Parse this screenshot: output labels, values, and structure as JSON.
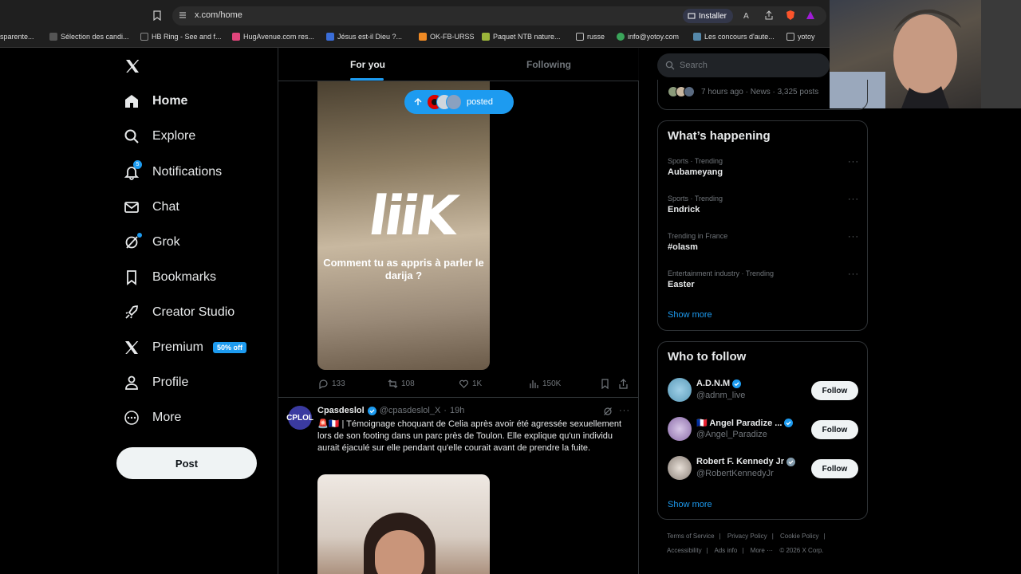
{
  "browser": {
    "url": "x.com/home",
    "install_label": "Installer",
    "bookmarks": [
      "sparente...",
      "Sélection des candi...",
      "HB Ring - See and f...",
      "HugAvenue.com res...",
      "Jésus est-il Dieu ?...",
      "OK-FB-URSS",
      "Paquet NTB nature...",
      "russe",
      "info@yotoy.com",
      "Les concours d'aute...",
      "yotoy"
    ]
  },
  "nav": {
    "items": [
      {
        "label": "Home",
        "icon": "home-icon"
      },
      {
        "label": "Explore",
        "icon": "search-icon"
      },
      {
        "label": "Notifications",
        "icon": "bell-icon",
        "badge": "5"
      },
      {
        "label": "Chat",
        "icon": "mail-icon"
      },
      {
        "label": "Grok",
        "icon": "grok-icon"
      },
      {
        "label": "Bookmarks",
        "icon": "bookmark-icon"
      },
      {
        "label": "Creator Studio",
        "icon": "rocket-icon"
      },
      {
        "label": "Premium",
        "icon": "x-logo-icon",
        "badge": "50% off"
      },
      {
        "label": "Profile",
        "icon": "person-icon"
      },
      {
        "label": "More",
        "icon": "more-circle-icon"
      }
    ],
    "post_label": "Post"
  },
  "feed": {
    "tabs": [
      "For you",
      "Following"
    ],
    "posted_pill": "posted",
    "tweet1": {
      "video_logo": "liiK",
      "video_caption": "Comment tu as appris à parler le darija ?",
      "replies": "133",
      "reposts": "108",
      "likes": "1K",
      "views": "150K"
    },
    "tweet2": {
      "avatar_text": "CPLOL",
      "name": "Cpasdeslol",
      "handle": "@cpasdeslol_X",
      "time": "19h",
      "text": "🚨🇫🇷 | Témoignage choquant de Celia après avoir été agressée sexuellement lors de son footing dans un parc près de Toulon. Elle explique qu'un individu aurait éjaculé sur elle pendant qu'elle courait avant de prendre la fuite."
    }
  },
  "sidebar": {
    "search_placeholder": "Search",
    "news_meta": "7 hours ago · News · 3,325 posts",
    "happening": {
      "title": "What’s happening",
      "trends": [
        {
          "category": "Sports · Trending",
          "name": "Aubameyang"
        },
        {
          "category": "Sports · Trending",
          "name": "Endrick"
        },
        {
          "category": "Trending in France",
          "name": "#olasm"
        },
        {
          "category": "Entertainment industry · Trending",
          "name": "Easter"
        }
      ],
      "show_more": "Show more"
    },
    "who_to_follow": {
      "title": "Who to follow",
      "accounts": [
        {
          "name": "A.D.N.M",
          "handle": "@adnm_live",
          "button": "Follow",
          "verified": "blue"
        },
        {
          "name": "🇫🇷 Angel Paradize ...",
          "handle": "@Angel_Paradize",
          "button": "Follow",
          "verified": "blue"
        },
        {
          "name": "Robert F. Kennedy Jr",
          "handle": "@RobertKennedyJr",
          "button": "Follow",
          "verified": "grey"
        }
      ],
      "show_more": "Show more"
    },
    "footer": {
      "links": [
        "Terms of Service",
        "Privacy Policy",
        "Cookie Policy",
        "Accessibility",
        "Ads info",
        "More ···"
      ],
      "copyright": "© 2026 X Corp."
    }
  },
  "colors": {
    "accent": "#1d9bf0",
    "background": "#000000",
    "border": "#2f3336",
    "muted": "#71767b"
  }
}
